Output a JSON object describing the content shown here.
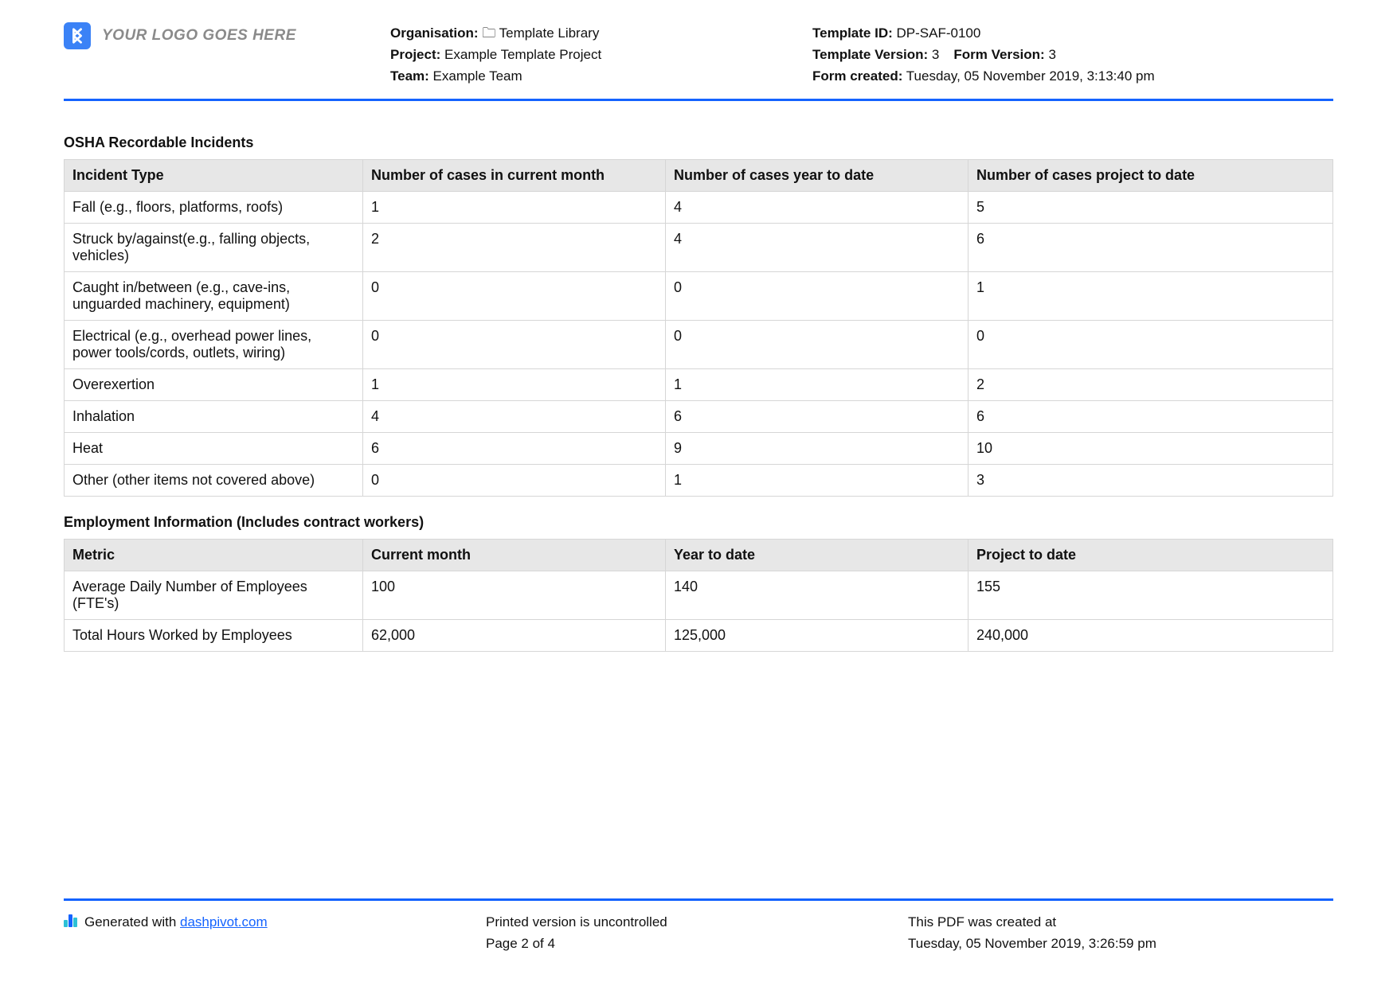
{
  "header": {
    "logo_text": "YOUR LOGO GOES HERE",
    "org_label": "Organisation:",
    "org_value": "🗀 Template Library",
    "project_label": "Project:",
    "project_value": "Example Template Project",
    "team_label": "Team:",
    "team_value": "Example Team",
    "template_id_label": "Template ID:",
    "template_id_value": "DP-SAF-0100",
    "template_version_label": "Template Version:",
    "template_version_value": "3",
    "form_version_label": "Form Version:",
    "form_version_value": "3",
    "form_created_label": "Form created:",
    "form_created_value": "Tuesday, 05 November 2019, 3:13:40 pm"
  },
  "incidents": {
    "title": "OSHA Recordable Incidents",
    "columns": [
      "Incident Type",
      "Number of cases in current month",
      "Number of cases year to date",
      "Number of cases project to date"
    ],
    "rows": [
      [
        "Fall (e.g., floors, platforms, roofs)",
        "1",
        "4",
        "5"
      ],
      [
        "Struck by/against(e.g., falling objects, vehicles)",
        "2",
        "4",
        "6"
      ],
      [
        "Caught in/between (e.g., cave-ins, unguarded machinery, equipment)",
        "0",
        "0",
        "1"
      ],
      [
        "Electrical (e.g., overhead power lines, power tools/cords, outlets, wiring)",
        "0",
        "0",
        "0"
      ],
      [
        "Overexertion",
        "1",
        "1",
        "2"
      ],
      [
        "Inhalation",
        "4",
        "6",
        "6"
      ],
      [
        "Heat",
        "6",
        "9",
        "10"
      ],
      [
        "Other (other items not covered above)",
        "0",
        "1",
        "3"
      ]
    ]
  },
  "employment": {
    "title": "Employment Information (Includes contract workers)",
    "columns": [
      "Metric",
      "Current month",
      "Year to date",
      "Project to date"
    ],
    "rows": [
      [
        "Average Daily Number of Employees (FTE's)",
        "100",
        "140",
        "155"
      ],
      [
        "Total Hours Worked by Employees",
        "62,000",
        "125,000",
        "240,000"
      ]
    ]
  },
  "footer": {
    "generated_text": "Generated with ",
    "generated_link": "dashpivot.com",
    "uncontrolled": "Printed version is uncontrolled",
    "page": "Page 2 of 4",
    "created_label": "This PDF was created at",
    "created_value": "Tuesday, 05 November 2019, 3:26:59 pm"
  }
}
